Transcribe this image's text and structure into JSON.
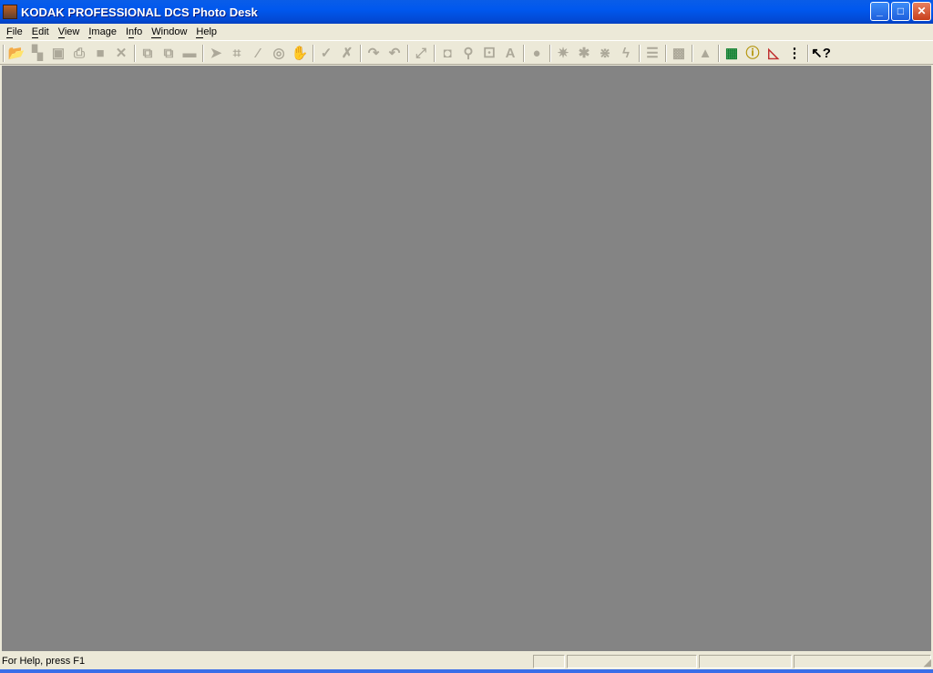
{
  "window": {
    "title": "KODAK PROFESSIONAL DCS Photo Desk",
    "controls": [
      "minimize",
      "maximize",
      "close"
    ]
  },
  "menu": [
    {
      "label": "File",
      "key": "F"
    },
    {
      "label": "Edit",
      "key": "E"
    },
    {
      "label": "View",
      "key": "V"
    },
    {
      "label": "Image",
      "key": "I"
    },
    {
      "label": "Info",
      "key": "n"
    },
    {
      "label": "Window",
      "key": "W"
    },
    {
      "label": "Help",
      "key": "H"
    }
  ],
  "toolbar": [
    {
      "name": "open",
      "glyph": "📂",
      "enabled": true
    },
    {
      "name": "open-multiple",
      "glyph": "▚",
      "enabled": false
    },
    {
      "name": "save",
      "glyph": "▣",
      "enabled": false
    },
    {
      "name": "print",
      "glyph": "⎙",
      "enabled": false
    },
    {
      "name": "acquire",
      "glyph": "■",
      "enabled": false
    },
    {
      "name": "close-image",
      "glyph": "✕",
      "enabled": false
    },
    {
      "sep": true
    },
    {
      "name": "copy",
      "glyph": "⧉",
      "enabled": false
    },
    {
      "name": "paste",
      "glyph": "⧉",
      "enabled": false
    },
    {
      "name": "clipboard",
      "glyph": "▬",
      "enabled": false
    },
    {
      "sep": true
    },
    {
      "name": "select",
      "glyph": "➤",
      "enabled": false
    },
    {
      "name": "crop",
      "glyph": "⌗",
      "enabled": false
    },
    {
      "name": "eyedropper",
      "glyph": "⁄",
      "enabled": false
    },
    {
      "name": "target",
      "glyph": "◎",
      "enabled": false
    },
    {
      "name": "hand",
      "glyph": "✋",
      "enabled": false
    },
    {
      "sep": true
    },
    {
      "name": "check",
      "glyph": "✓",
      "enabled": false
    },
    {
      "name": "uncheck",
      "glyph": "✗",
      "enabled": false
    },
    {
      "sep": true
    },
    {
      "name": "rotate-right",
      "glyph": "↷",
      "enabled": false
    },
    {
      "name": "rotate-left",
      "glyph": "↶",
      "enabled": false
    },
    {
      "sep": true
    },
    {
      "name": "fit-window",
      "glyph": "⤢",
      "enabled": false
    },
    {
      "sep": true
    },
    {
      "name": "mask",
      "glyph": "◘",
      "enabled": false
    },
    {
      "name": "color-dropper",
      "glyph": "⚲",
      "enabled": false
    },
    {
      "name": "noise",
      "glyph": "⚀",
      "enabled": false
    },
    {
      "name": "text",
      "glyph": "A",
      "enabled": false
    },
    {
      "sep": true
    },
    {
      "name": "circle",
      "glyph": "●",
      "enabled": false
    },
    {
      "sep": true
    },
    {
      "name": "brightness",
      "glyph": "✷",
      "enabled": false
    },
    {
      "name": "sharpen",
      "glyph": "✱",
      "enabled": false
    },
    {
      "name": "contrast",
      "glyph": "⋇",
      "enabled": false
    },
    {
      "name": "flash",
      "glyph": "ϟ",
      "enabled": false
    },
    {
      "sep": true
    },
    {
      "name": "adjustments",
      "glyph": "☰",
      "enabled": false
    },
    {
      "sep": true
    },
    {
      "name": "texture",
      "glyph": "▩",
      "enabled": false
    },
    {
      "sep": true
    },
    {
      "name": "triangle",
      "glyph": "▲",
      "enabled": false
    },
    {
      "sep": true
    },
    {
      "name": "image-select",
      "glyph": "▦",
      "enabled": true
    },
    {
      "name": "image-info",
      "glyph": "ⓘ",
      "enabled": true
    },
    {
      "name": "histogram",
      "glyph": "◺",
      "enabled": true
    },
    {
      "name": "list",
      "glyph": "⋮",
      "enabled": true
    },
    {
      "sep": true
    },
    {
      "name": "context-help",
      "glyph": "↖?",
      "enabled": true
    }
  ],
  "status": {
    "text": "For Help, press F1"
  }
}
